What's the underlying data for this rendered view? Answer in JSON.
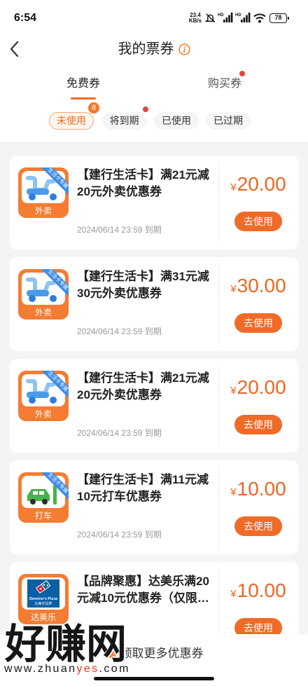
{
  "status_bar": {
    "time": "6:54",
    "net_speed": "23.4",
    "net_speed_unit": "KB/s",
    "signal_labels": [
      "HD",
      "HD"
    ],
    "battery": "78",
    "icons": [
      "mute-bell-icon",
      "signal-icon",
      "signal-icon",
      "wifi-icon",
      "battery-icon"
    ]
  },
  "header": {
    "back_icon": "back-arrow-icon",
    "title": "我的票券",
    "title_icon": "info-icon"
  },
  "tabs": [
    {
      "label": "免费券",
      "active": true,
      "red_dot": false
    },
    {
      "label": "购买券",
      "active": false,
      "red_dot": true
    }
  ],
  "filters": [
    {
      "label": "未使用",
      "active": true,
      "badge": "8",
      "red_dot": false
    },
    {
      "label": "将到期",
      "active": false,
      "red_dot": true
    },
    {
      "label": "已使用",
      "active": false,
      "red_dot": false
    },
    {
      "label": "已过期",
      "active": false,
      "red_dot": false
    }
  ],
  "coupons": [
    {
      "icon": "scooter-icon",
      "category": "外卖",
      "ribbon": "生活卡专属",
      "title": "【建行生活卡】满21元减20元外卖优惠券",
      "expiry": "2024/06/14 23:59 到期",
      "currency": "¥",
      "amount": "20.00",
      "action": "去使用"
    },
    {
      "icon": "scooter-icon",
      "category": "外卖",
      "ribbon": "生活卡专属",
      "title": "【建行生活卡】满31元减30元外卖优惠券",
      "expiry": "2024/06/14 23:59 到期",
      "currency": "¥",
      "amount": "30.00",
      "action": "去使用"
    },
    {
      "icon": "scooter-icon",
      "category": "外卖",
      "ribbon": "生活卡专属",
      "title": "【建行生活卡】满21元减20元外卖优惠券",
      "expiry": "2024/06/14 23:59 到期",
      "currency": "¥",
      "amount": "20.00",
      "action": "去使用"
    },
    {
      "icon": "car-icon",
      "category": "打车",
      "ribbon": "生活卡专属",
      "title": "【建行生活卡】满11元减10元打车优惠券",
      "expiry": "2024/06/14 23:59 到期",
      "currency": "¥",
      "amount": "10.00",
      "action": "去使用"
    },
    {
      "icon": "dominos-logo",
      "category": "达美乐",
      "logo_text": [
        "Domino's Pizza",
        "达美乐比萨"
      ],
      "title": "【品牌聚惠】达美乐满20元减10元优惠券（仅限…",
      "currency": "¥",
      "amount": "10.00",
      "action": "去使用"
    }
  ],
  "footer": {
    "icon": "coupon-ticket-icon",
    "label": "领取更多优惠券"
  },
  "watermark": {
    "logo_text": "好赚网",
    "url_parts": [
      "www.zhuan",
      "yes",
      ".com"
    ]
  },
  "colors": {
    "accent": "#f26b22",
    "price": "#ef6520",
    "button": "#f06b28",
    "ribbon": "#3d8de6",
    "notice_dot": "#e8453c",
    "page_background": "#f4f4f4"
  }
}
